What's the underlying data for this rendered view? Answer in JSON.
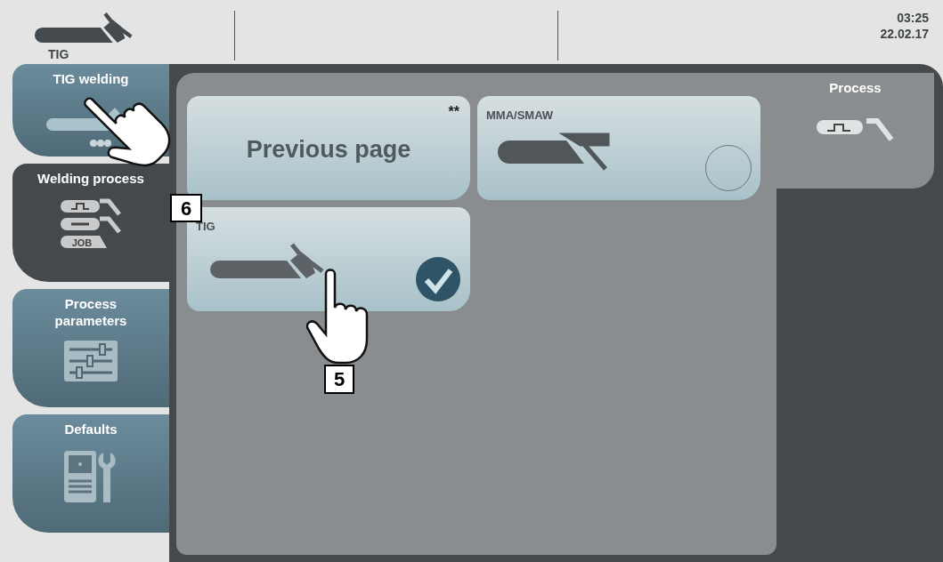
{
  "header": {
    "process_label": "TIG",
    "time": "03:25",
    "date": "22.02.17"
  },
  "sidebar": {
    "items": [
      {
        "label": "TIG welding",
        "kind": "torch",
        "selected": false
      },
      {
        "label": "Welding process",
        "kind": "process-list",
        "selected": true,
        "icon_text": "JOB"
      },
      {
        "label": "Process parameters",
        "kind": "sliders",
        "selected": false
      },
      {
        "label": "Defaults",
        "kind": "machine",
        "selected": false
      }
    ]
  },
  "tiles": [
    {
      "kind": "back",
      "label": "Previous page",
      "note": "**"
    },
    {
      "kind": "electrode",
      "label": "MMA/SMAW",
      "selected": false
    },
    {
      "kind": "torch",
      "label": "TIG",
      "selected": true
    }
  ],
  "side_panel": {
    "label": "Process"
  },
  "callouts": [
    {
      "number": "6"
    },
    {
      "number": "5"
    }
  ]
}
